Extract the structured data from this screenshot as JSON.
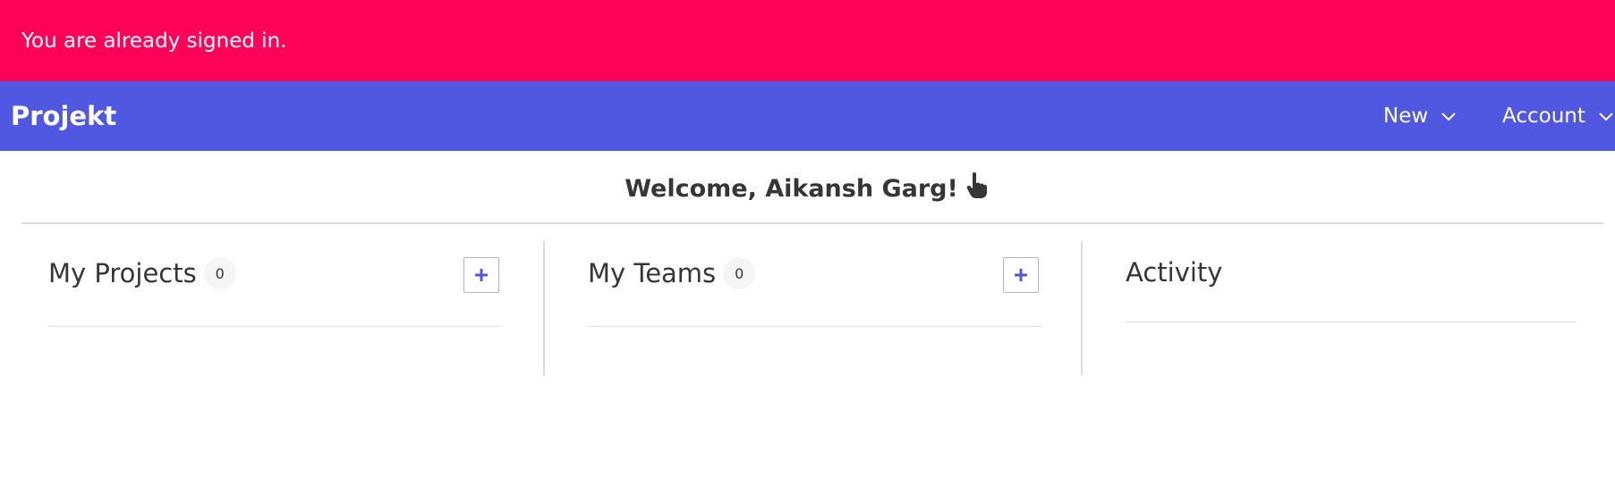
{
  "flash": {
    "message": "You are already signed in.",
    "color": "#ff0359"
  },
  "navbar": {
    "brand": "Projekt",
    "color": "#5057e0",
    "items": [
      {
        "label": "New",
        "icon": "chevron-down-icon"
      },
      {
        "label": "Account",
        "icon": "chevron-down-icon"
      }
    ]
  },
  "welcome": {
    "text": "Welcome, Aikansh Garg!",
    "icon": "pointing-hand-icon"
  },
  "columns": [
    {
      "title": "My Projects",
      "count": "0",
      "action_icon": "plus-icon"
    },
    {
      "title": "My Teams",
      "count": "0",
      "action_icon": "plus-icon"
    },
    {
      "title": "Activity"
    }
  ]
}
